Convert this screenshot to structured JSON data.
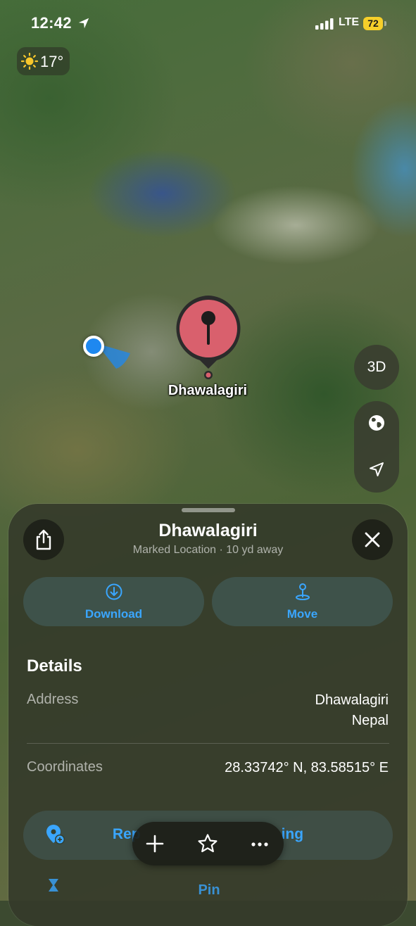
{
  "status_bar": {
    "time": "12:42",
    "network": "LTE",
    "battery": "72",
    "icons": [
      "location-arrow-icon",
      "signal-bars-icon",
      "battery-icon"
    ]
  },
  "weather": {
    "temperature": "17°",
    "icon": "sun-icon"
  },
  "map": {
    "pin_label": "Dhawalagiri",
    "pin_color": "#d9606d",
    "user_location_color": "#1e88f0",
    "controls": {
      "three_d_label": "3D",
      "globe_icon": "globe-icon",
      "locate_icon": "location-arrow-icon"
    }
  },
  "sheet": {
    "title": "Dhawalagiri",
    "subtitle": "Marked Location · 10 yd away",
    "actions": [
      {
        "label": "Download",
        "icon": "download-icon"
      },
      {
        "label": "Move",
        "icon": "move-pin-icon"
      }
    ],
    "details": {
      "heading": "Details",
      "address_label": "Address",
      "address_line1": "Dhawalagiri",
      "address_line2": "Nepal",
      "coordinates_label": "Coordinates",
      "coordinates_value": "28.33742° N, 83.58515° E"
    },
    "partial_row_1": {
      "visible_text_left": "Rep",
      "visible_text_right": "ing"
    },
    "partial_row_2": {
      "visible_text": "Pin"
    },
    "accent": "#3aa6ff"
  },
  "toolbar": {
    "icons": [
      "plus-icon",
      "star-icon",
      "more-icon"
    ]
  }
}
